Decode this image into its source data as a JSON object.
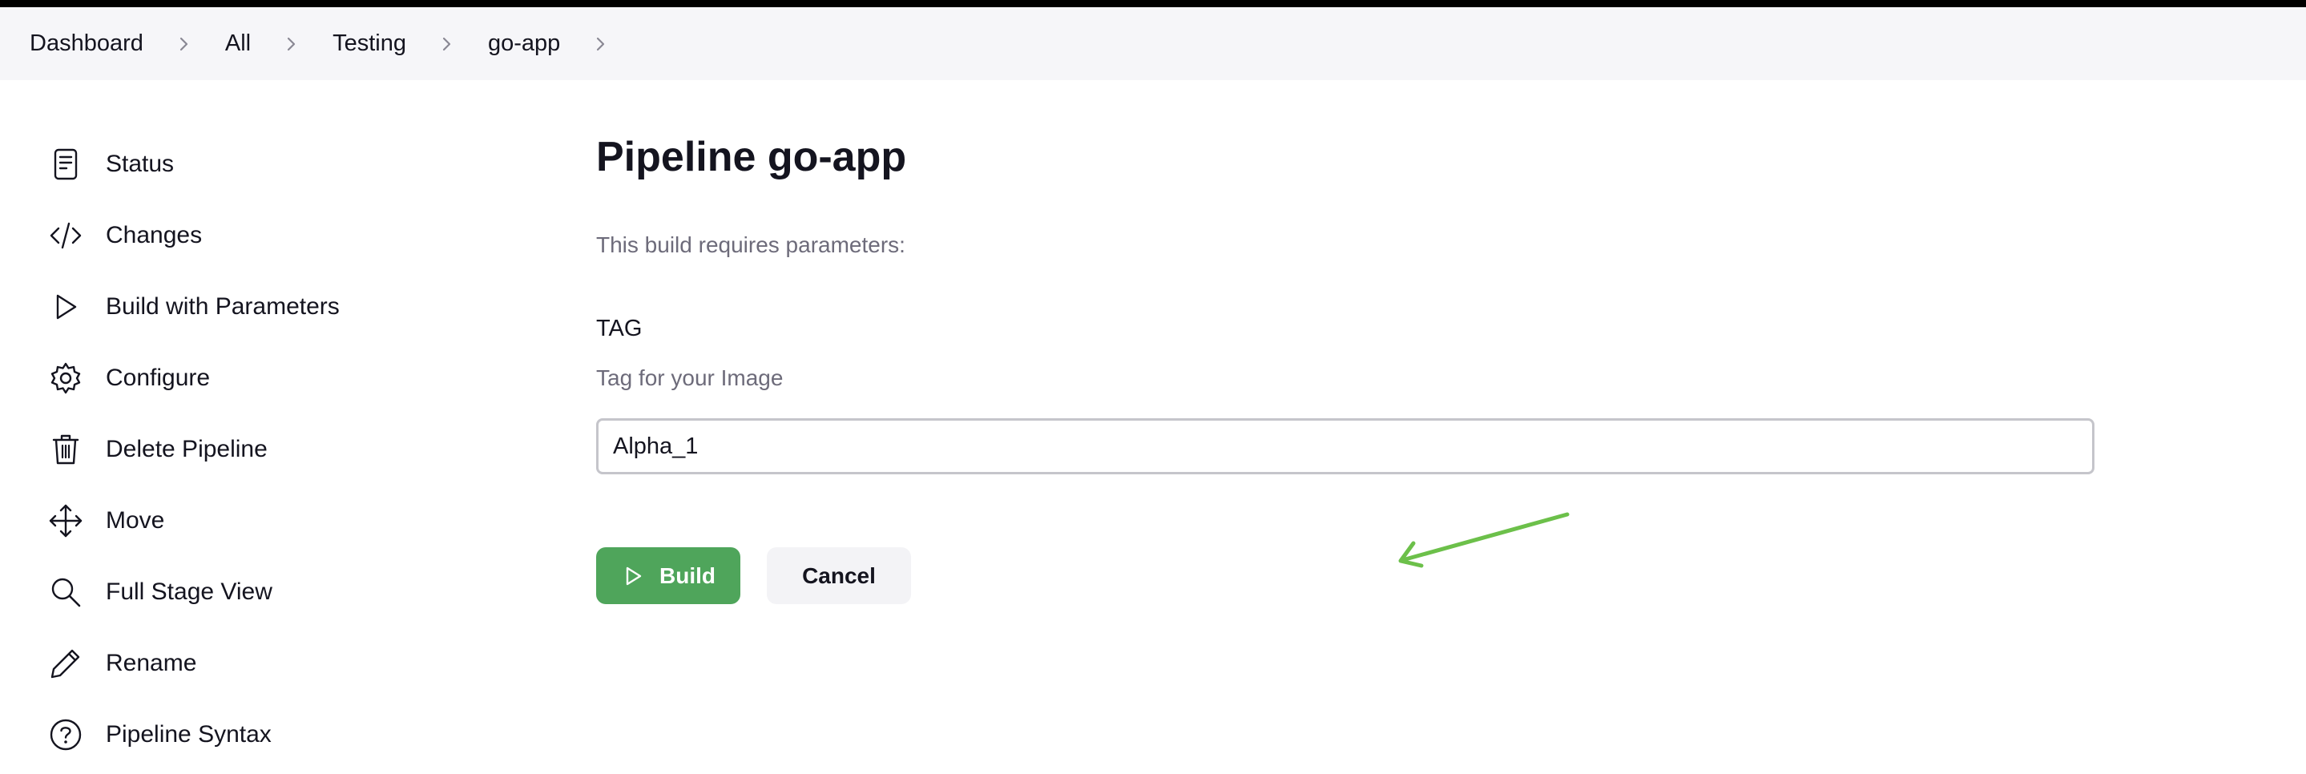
{
  "breadcrumbs": [
    {
      "label": "Dashboard"
    },
    {
      "label": "All"
    },
    {
      "label": "Testing"
    },
    {
      "label": "go-app"
    }
  ],
  "sidebar": {
    "items": [
      {
        "label": "Status",
        "icon": "document-icon"
      },
      {
        "label": "Changes",
        "icon": "code-icon"
      },
      {
        "label": "Build with Parameters",
        "icon": "play-icon"
      },
      {
        "label": "Configure",
        "icon": "gear-icon"
      },
      {
        "label": "Delete Pipeline",
        "icon": "trash-icon"
      },
      {
        "label": "Move",
        "icon": "move-arrows-icon"
      },
      {
        "label": "Full Stage View",
        "icon": "search-icon"
      },
      {
        "label": "Rename",
        "icon": "pencil-icon"
      },
      {
        "label": "Pipeline Syntax",
        "icon": "help-circle-icon"
      }
    ]
  },
  "main": {
    "title": "Pipeline go-app",
    "intro": "This build requires parameters:",
    "parameter": {
      "name": "TAG",
      "description": "Tag for your Image",
      "value": "Alpha_1"
    },
    "build_label": "Build",
    "cancel_label": "Cancel"
  },
  "colors": {
    "accent_green": "#4fa55b",
    "annotation_arrow": "#6cc04a",
    "breadcrumb_bg": "#f6f6f9"
  }
}
